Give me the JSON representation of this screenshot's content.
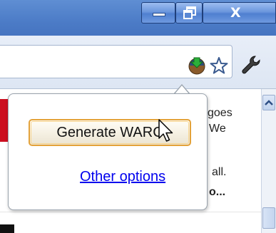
{
  "window": {
    "minimize_glyph": "—",
    "maximize_glyph": "⧉",
    "close_glyph": "X"
  },
  "toolbar": {
    "extension_icon": "warc-extension-icon",
    "bookmark_icon": "star-icon",
    "menu_icon": "wrench-icon"
  },
  "page": {
    "line1": "goes",
    "line2": "We",
    "line3": "all.",
    "line4": "o..."
  },
  "popup": {
    "generate_label": "Generate WARC",
    "other_options_label": "Other options"
  },
  "colors": {
    "titlebar": "#4c7cc7",
    "button_border": "#e3a23a",
    "link": "#0000ee"
  }
}
